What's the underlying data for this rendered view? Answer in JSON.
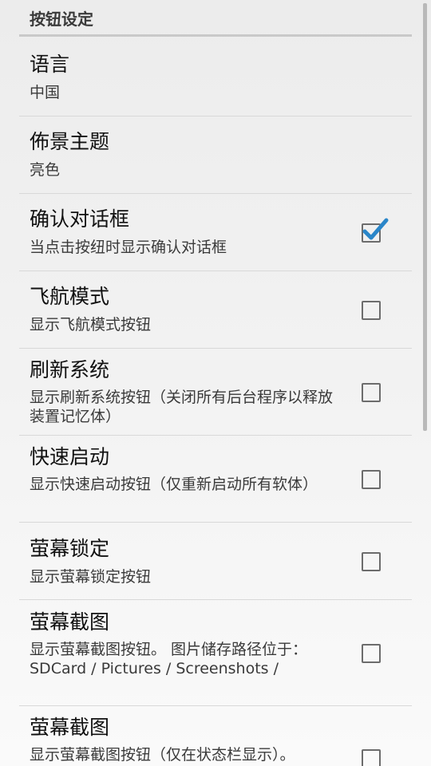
{
  "section": {
    "title": "按钮设定"
  },
  "prefs": [
    {
      "title": "语言",
      "summary": "中国"
    },
    {
      "title": "佈景主题",
      "summary": "亮色"
    },
    {
      "title": "确认对话框",
      "summary": "当点击按纽时显示确认对话框",
      "checked": true
    },
    {
      "title": "飞航模式",
      "summary": "显示飞航模式按钮",
      "checked": false
    },
    {
      "title": "刷新系统",
      "summary": "显示刷新系统按钮（关闭所有后台程序以释放装置记忆体）",
      "checked": false
    },
    {
      "title": "快速启动",
      "summary": "显示快速启动按钮（仅重新启动所有软体）",
      "checked": false
    },
    {
      "title": "萤幕锁定",
      "summary": "显示萤幕锁定按钮",
      "checked": false
    },
    {
      "title": "萤幕截图",
      "summary": "显示萤幕截图按钮。 图片储存路径位于：SDCard / Pictures / Screenshots /",
      "checked": false
    },
    {
      "title": "萤幕截图",
      "summary": "显示萤幕截图按钮（仅在状态栏显示）。",
      "checked": false
    }
  ],
  "colors": {
    "accent": "#2a86c9",
    "checkbox_border": "#6c6c6c",
    "divider": "#d8d8d8"
  },
  "icons": {
    "checkmark": "check-icon"
  }
}
